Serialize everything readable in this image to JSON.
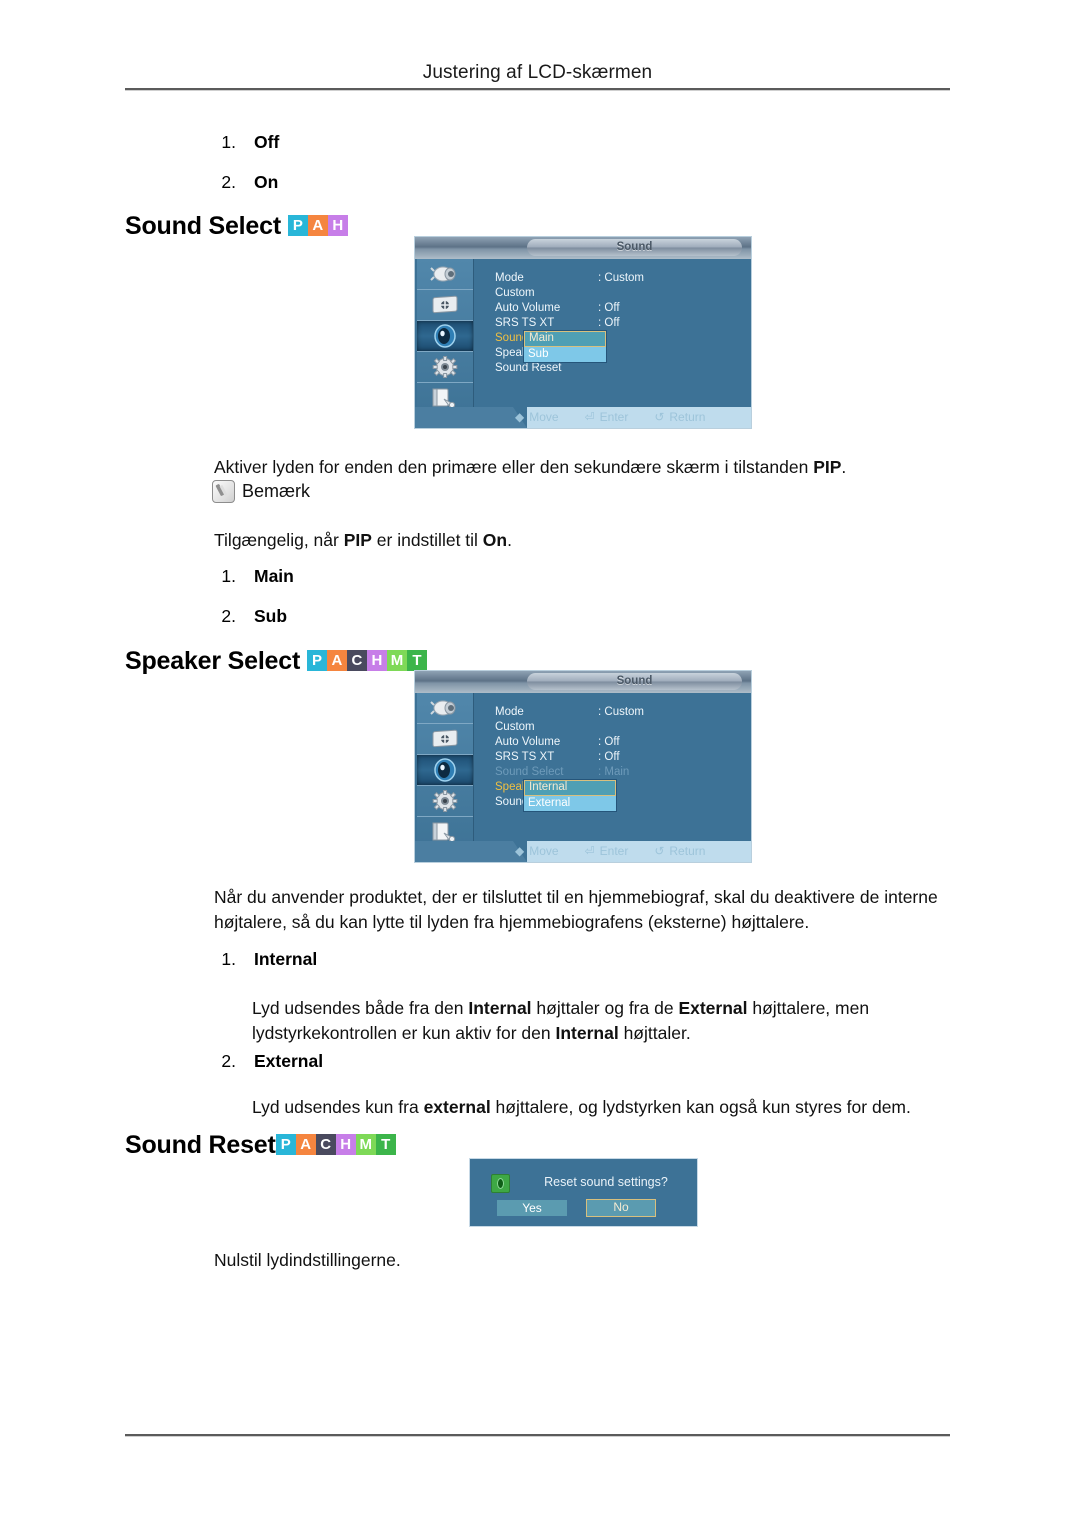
{
  "page": {
    "header_title": "Justering af LCD-skærmen"
  },
  "intro_list": [
    {
      "num": "1.",
      "label": "Off"
    },
    {
      "num": "2.",
      "label": "On"
    }
  ],
  "badge_colors": {
    "P": "#29b6d8",
    "A": "#f5853f",
    "C": "#4a4a5e",
    "H": "#c77ee8",
    "M": "#7ed957",
    "T": "#3cb54a"
  },
  "sections": {
    "sound_select": {
      "heading": "Sound Select",
      "badges": [
        "P",
        "A",
        "H"
      ],
      "description": "Aktiver lyden for enden den primære eller den sekundære skærm i tilstanden PIP.",
      "note_label": "Bemærk",
      "note_text": "Tilgængelig, når PIP er indstillet til On.",
      "options": [
        {
          "num": "1.",
          "label": "Main"
        },
        {
          "num": "2.",
          "label": "Sub"
        }
      ]
    },
    "speaker_select": {
      "heading": "Speaker Select",
      "badges": [
        "P",
        "A",
        "C",
        "H",
        "M",
        "T"
      ],
      "description": "Når du anvender produktet, der er tilsluttet til en hjemmebiograf, skal du deaktivere de interne højtalere, så du kan lytte til lyden fra hjemmebiografens (eksterne) højttalere.",
      "options": [
        {
          "num": "1.",
          "label": "Internal",
          "body": "Lyd udsendes både fra den Internal højttaler og fra de External højttalere, men lydstyrkekontrollen er kun aktiv for den Internal højttaler."
        },
        {
          "num": "2.",
          "label": "External",
          "body": "Lyd udsendes kun fra external højttalere, og lydstyrken kan også kun styres for dem."
        }
      ]
    },
    "sound_reset": {
      "heading": "Sound Reset",
      "badges": [
        "P",
        "A",
        "C",
        "H",
        "M",
        "T"
      ],
      "description": "Nulstil lydindstillingerne."
    }
  },
  "osd1": {
    "title": "Sound",
    "icons": [
      "input-source-icon",
      "picture-icon",
      "sound-icon",
      "setup-icon",
      "multi-control-icon"
    ],
    "selected_icon_index": 2,
    "rows": [
      {
        "label": "Mode",
        "value": ": Custom",
        "state": "normal"
      },
      {
        "label": "Custom",
        "value": "",
        "state": "normal"
      },
      {
        "label": "Auto Volume",
        "value": ": Off",
        "state": "normal"
      },
      {
        "label": "SRS TS XT",
        "value": ": Off",
        "state": "normal"
      },
      {
        "label": "Sound Select",
        "value": ":",
        "state": "active"
      },
      {
        "label": "Speaker Select",
        "value": ":",
        "state": "normal"
      },
      {
        "label": "Sound Reset",
        "value": "",
        "state": "normal"
      }
    ],
    "popup": {
      "options": [
        "Main",
        "Sub"
      ],
      "selected": "Main"
    },
    "hints": [
      {
        "glyph": "◆",
        "label": "Move"
      },
      {
        "glyph": "⏎",
        "label": "Enter"
      },
      {
        "glyph": "↺",
        "label": "Return"
      }
    ]
  },
  "osd2": {
    "title": "Sound",
    "icons": [
      "input-source-icon",
      "picture-icon",
      "sound-icon",
      "setup-icon",
      "multi-control-icon"
    ],
    "selected_icon_index": 2,
    "rows": [
      {
        "label": "Mode",
        "value": ": Custom",
        "state": "normal"
      },
      {
        "label": "Custom",
        "value": "",
        "state": "normal"
      },
      {
        "label": "Auto Volume",
        "value": ": Off",
        "state": "normal"
      },
      {
        "label": "SRS TS XT",
        "value": ": Off",
        "state": "normal"
      },
      {
        "label": "Sound Select",
        "value": ": Main",
        "state": "dim"
      },
      {
        "label": "Speaker Select",
        "value": ":",
        "state": "active"
      },
      {
        "label": "Sound Reset",
        "value": "",
        "state": "normal"
      }
    ],
    "popup": {
      "options": [
        "Internal",
        "External"
      ],
      "selected": "Internal"
    },
    "hints": [
      {
        "glyph": "◆",
        "label": "Move"
      },
      {
        "glyph": "⏎",
        "label": "Enter"
      },
      {
        "glyph": "↺",
        "label": "Return"
      }
    ]
  },
  "reset_dialog": {
    "message": "Reset sound settings?",
    "yes_label": "Yes",
    "no_label": "No",
    "selected": "No"
  }
}
